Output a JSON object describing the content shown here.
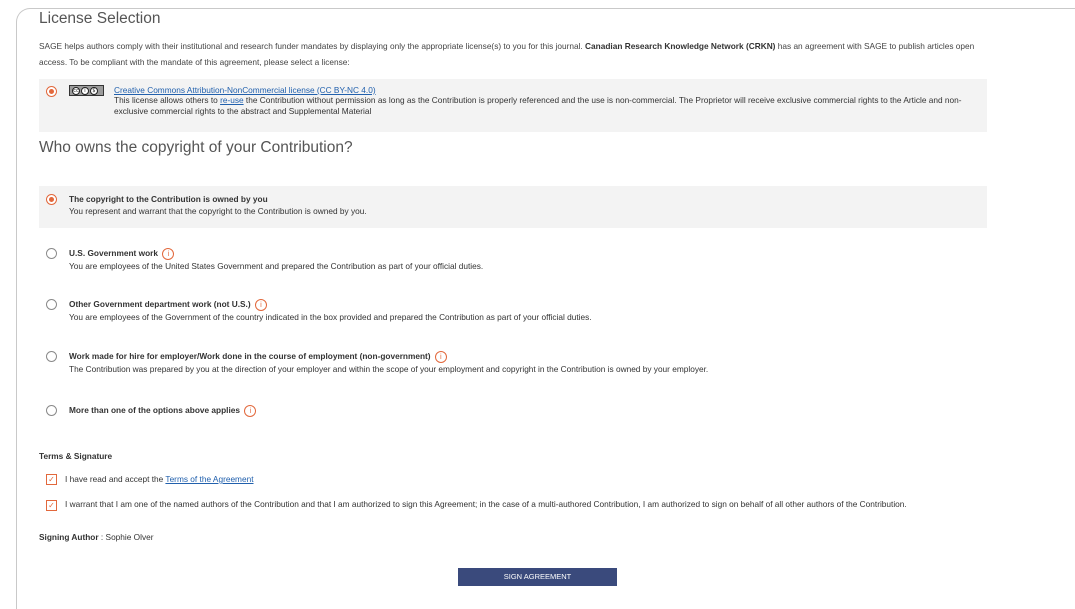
{
  "license": {
    "section_title": "License Selection",
    "intro_prefix": "SAGE helps authors comply with their institutional and research funder mandates by displaying only the appropriate license(s) to you for this journal.",
    "intro_org": "Canadian Research Knowledge Network (CRKN)",
    "intro_suffix": "has an agreement with SAGE to publish articles open access. To be compliant with the mandate of this agreement, please select a license:",
    "option": {
      "link_text": "Creative Commons Attribution-NonCommercial license (CC BY-NC 4.0)",
      "desc_prefix": "This license allows others to",
      "desc_link": "re-use",
      "desc_suffix": "the Contribution without permission as long as the Contribution is properly referenced and the use is non-commercial. The Proprietor will receive exclusive commercial rights to the Article and non-exclusive commercial rights to the abstract and Supplemental Material",
      "selected": true
    }
  },
  "copyright": {
    "question": "Who owns the copyright of your Contribution?",
    "options": [
      {
        "title": "The copyright to the Contribution is owned by you",
        "desc": "You represent and warrant that the copyright to the Contribution is owned by you.",
        "selected": true
      },
      {
        "title": "U.S. Government work",
        "desc": "You are employees of the United States Government and prepared the Contribution as part of your official duties.",
        "selected": false
      },
      {
        "title": "Other Government department work (not U.S.)",
        "desc": "You are employees of the Government of the country indicated in the box provided and prepared the Contribution as part of your official duties.",
        "selected": false
      },
      {
        "title": "Work made for hire for employer/Work done in the course of employment (non-government)",
        "desc": "The Contribution was prepared by you at the direction of your employer and within the scope of your employment and copyright in the Contribution is owned by your employer.",
        "selected": false
      },
      {
        "title": "More than one of the options above applies",
        "desc": "",
        "selected": false
      }
    ],
    "info_glyph": "i"
  },
  "terms": {
    "heading": "Terms & Signature",
    "accept_prefix": "I have read and accept the",
    "accept_link": "Terms of the Agreement",
    "warrant_text": "I warrant that I am one of the named authors of the Contribution and that I am authorized to sign this Agreement; in the case of a multi-authored Contribution, I am authorized to sign on behalf of all other authors of the Contribution.",
    "accept_checked": true,
    "warrant_checked": true,
    "check_glyph": "✓"
  },
  "signing": {
    "label": "Signing Author",
    "separator": " : ",
    "name": "Sophie Olver"
  },
  "actions": {
    "sign_label": "SIGN AGREEMENT"
  },
  "cc_badge": {
    "glyphs": [
      "cc",
      "i",
      "$"
    ]
  },
  "colors": {
    "accent": "#e2683c",
    "link": "#2160ad",
    "button": "#3a4a7c",
    "selected_bg": "#f3f3f3"
  }
}
